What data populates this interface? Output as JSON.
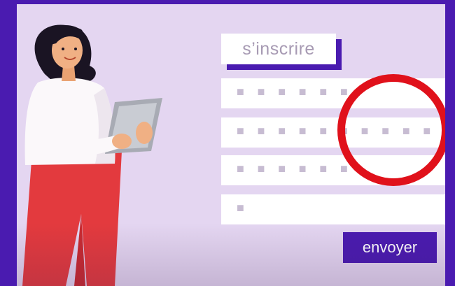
{
  "form": {
    "title": "s’inscrire",
    "fields": [
      {
        "placeholder": "■ ■ ■ ■ ■ ■"
      },
      {
        "placeholder": "■ ■ ■ ■ ■ ■ ■ ■ ■ ■ ■ ■"
      },
      {
        "placeholder": "■ ■ ■ ■ ■ ■"
      },
      {
        "placeholder": "■"
      }
    ],
    "submit_label": "envoyer"
  },
  "illustration": {
    "character": "woman holding tablet",
    "highlight": "red-circle"
  },
  "colors": {
    "frame": "#4a1bb0",
    "background": "#e4d6f1",
    "accent_red": "#e0111b",
    "pants_red": "#e33a3e",
    "placeholder_gray": "#c7bcd2"
  }
}
